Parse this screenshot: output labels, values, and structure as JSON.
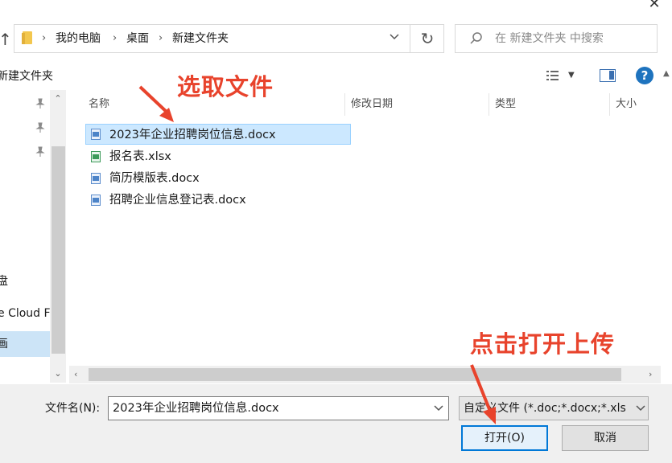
{
  "window": {
    "close_glyph": "✕"
  },
  "nav": {
    "up_glyph": "↑",
    "breadcrumbs": [
      "我的电脑",
      "桌面",
      "新建文件夹"
    ],
    "separator": "›",
    "dropdown_glyph": "⌄",
    "refresh_glyph": "↻",
    "search_placeholder": "在 新建文件夹 中搜索"
  },
  "toolbar": {
    "new_folder_label": "新建文件夹",
    "help_glyph": "?"
  },
  "sidebar": {
    "pin_glyph": "📌",
    "items": [
      {
        "label": "盘"
      },
      {
        "label": "e Cloud F"
      },
      {
        "label": "画"
      },
      {
        "label": ""
      }
    ]
  },
  "columns": {
    "name": "名称",
    "date": "修改日期",
    "type": "类型",
    "size": "大小"
  },
  "files": [
    {
      "name": "2023年企业招聘岗位信息.docx",
      "icon": "word-icon",
      "selected": true
    },
    {
      "name": "报名表.xlsx",
      "icon": "excel-icon",
      "selected": false
    },
    {
      "name": "简历模版表.docx",
      "icon": "word-icon",
      "selected": false
    },
    {
      "name": "招聘企业信息登记表.docx",
      "icon": "word-icon",
      "selected": false
    }
  ],
  "footer": {
    "filename_label": "文件名(N):",
    "filename_value": "2023年企业招聘岗位信息.docx",
    "filetype_value": "自定义文件 (*.doc;*.docx;*.xls",
    "open_button": "打开(O)",
    "cancel_button": "取消"
  },
  "annotations": {
    "select_file": "选取文件",
    "click_open": "点击打开上传",
    "color": "#e8432c"
  },
  "colors": {
    "selection": "#cce8ff",
    "accent": "#0078d7",
    "help": "#1e73be"
  }
}
